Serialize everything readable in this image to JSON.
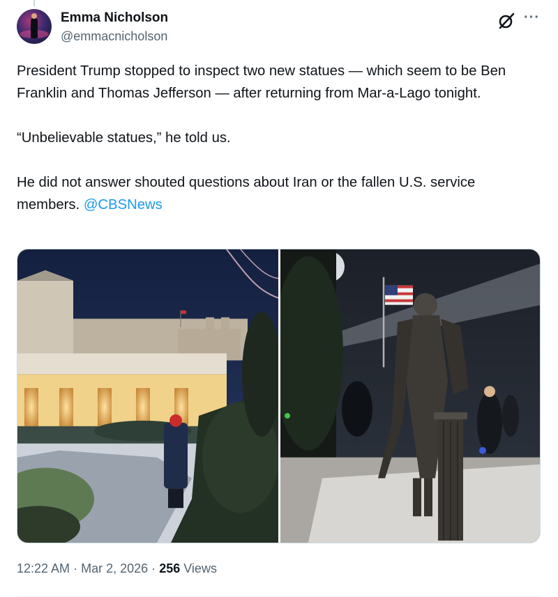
{
  "author": {
    "name": "Emma Nicholson",
    "handle": "@emmacnicholson"
  },
  "tweet": {
    "paragraphs": [
      "President Trump stopped to inspect two new statues — which seem to be Ben Franklin and Thomas Jefferson — after returning from Mar-a-Lago tonight.",
      "“Unbelievable statues,” he told us.",
      "He did not answer shouted questions about Iran or the fallen U.S. service members."
    ],
    "mention": "@CBSNews"
  },
  "meta": {
    "time": "12:22 AM",
    "separator_1": "·",
    "date": "Mar 2, 2026",
    "separator_2": "·",
    "views_count": "256",
    "views_label": "Views"
  },
  "icons": {
    "grok": "grok-icon",
    "more": "more-options-icon"
  },
  "colors": {
    "text": "#0f1419",
    "secondary": "#536471",
    "link": "#1d9bf0"
  }
}
